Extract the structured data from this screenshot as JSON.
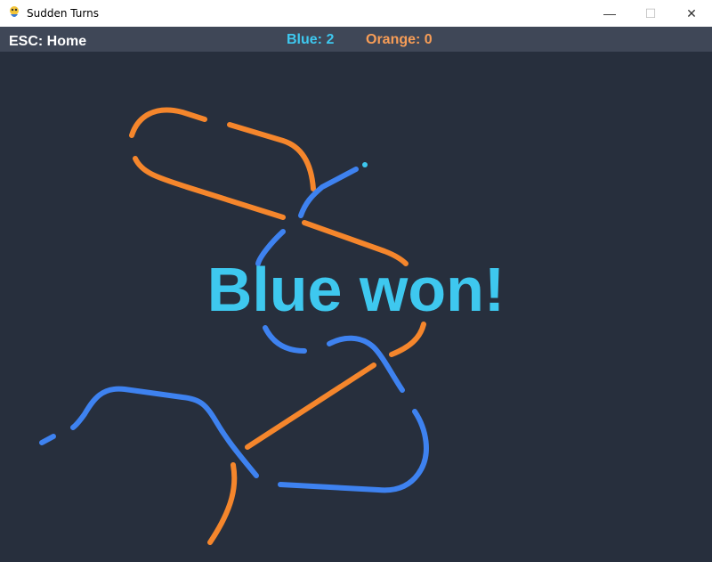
{
  "window": {
    "title": "Sudden Turns",
    "icon": "pygame-snake-icon",
    "minimize_glyph": "—",
    "maximize_glyph": "☐",
    "close_glyph": "✕"
  },
  "hud": {
    "home_hint": "ESC: Home",
    "blue_score": "Blue: 2",
    "orange_score": "Orange: 0"
  },
  "result": {
    "message": "Blue won!"
  },
  "colors": {
    "background": "#272f3d",
    "hud_bar": "#3f4757",
    "blue": "#3e82f0",
    "blue_head": "#3ec8ef",
    "orange": "#f5862c"
  }
}
